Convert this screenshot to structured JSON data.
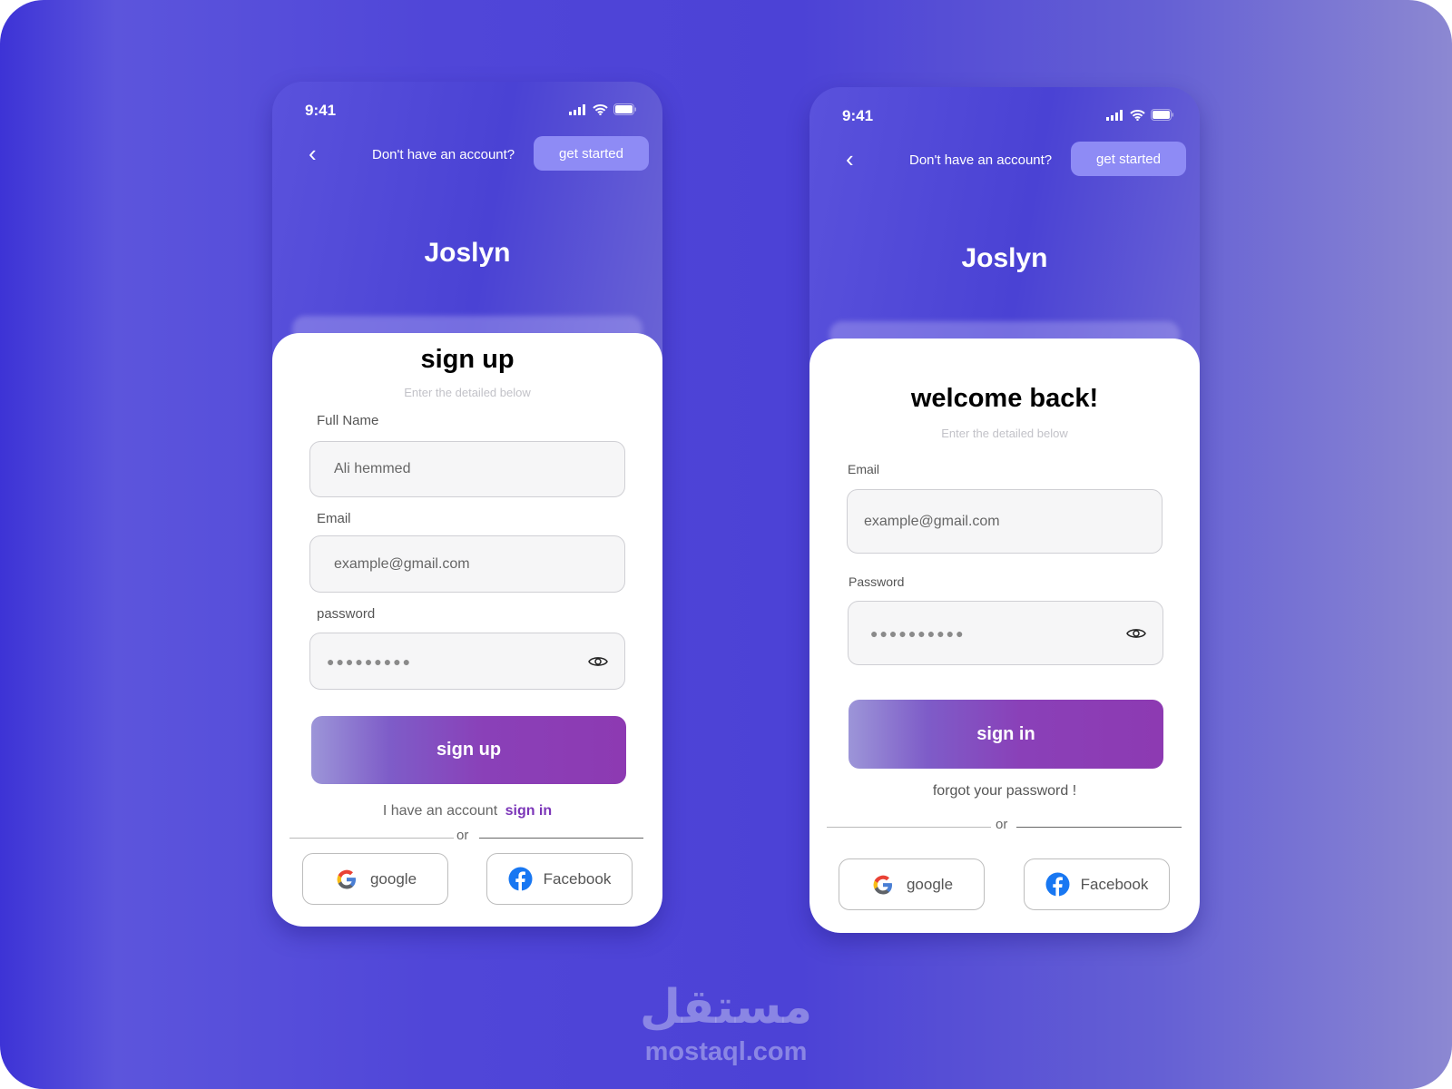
{
  "status_bar": {
    "time": "9:41",
    "icons": [
      "signal-icon",
      "wifi-icon",
      "battery-icon"
    ]
  },
  "header": {
    "prompt": "Don't have an account?",
    "get_started": "get started",
    "brand": "Joslyn"
  },
  "signup": {
    "title": "sign up",
    "subtitle": "Enter the detailed below",
    "full_name_label": "Full Name",
    "full_name_value": "Ali hemmed",
    "email_label": "Email",
    "email_value": "example@gmail.com",
    "password_label": "password",
    "password_value": "●●●●●●●●●",
    "submit": "sign up",
    "have_account": "I have an account",
    "sign_in_link": "sign in",
    "or": "or",
    "google": "google",
    "facebook": "Facebook"
  },
  "signin": {
    "title": "welcome back!",
    "subtitle": "Enter the detailed below",
    "email_label": "Email",
    "email_value": "example@gmail.com",
    "password_label": "Password",
    "password_value": "●●●●●●●●●●",
    "submit": "sign in",
    "forgot": "forgot your password !",
    "or": "or",
    "google": "google",
    "facebook": "Facebook"
  },
  "watermark": {
    "arabic": "مستقل",
    "latin": "mostaql.com"
  },
  "colors": {
    "accent": "#8e8bf5",
    "button_end": "#8d3ab2",
    "link": "#7b35b8",
    "facebook": "#1877f2"
  }
}
